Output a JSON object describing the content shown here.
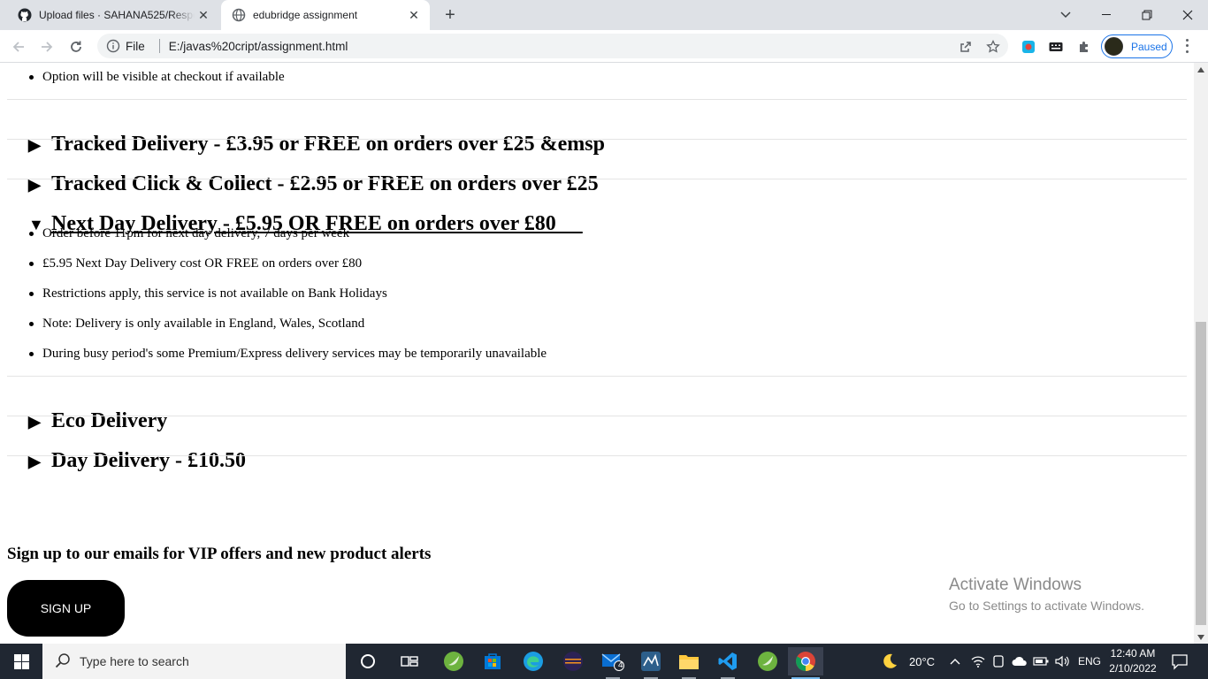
{
  "browser": {
    "tabs": [
      {
        "title": "Upload files · SAHANA525/Respo",
        "favicon": "github-icon"
      },
      {
        "title": "edubridge assignment",
        "favicon": "globe-icon"
      }
    ],
    "address": {
      "scheme_label": "File",
      "url": "E:/javas%20cript/assignment.html"
    },
    "profile_status": "Paused"
  },
  "page": {
    "top_bullet": "Option will be visible at checkout if available",
    "sections": [
      {
        "title": "Tracked Delivery - £3.95 or FREE on orders over £25 &emsp",
        "open": false
      },
      {
        "title": "Tracked Click & Collect - £2.95 or FREE on orders over £25",
        "open": false
      },
      {
        "title": "Next Day Delivery - £5.95 OR FREE on orders over £80     ",
        "open": true,
        "items": [
          "Order before 11pm for next day delivery, 7 days per week",
          "£5.95 Next Day Delivery cost OR FREE on orders over £80",
          "Restrictions apply, this service is not available on Bank Holidays",
          "Note: Delivery is only available in England, Wales, Scotland",
          "During busy period's some Premium/Express delivery services may be temporarily unavailable"
        ]
      },
      {
        "title": "Eco Delivery",
        "open": false
      },
      {
        "title": "Day Delivery - £10.50",
        "open": false
      }
    ],
    "signup_heading": "Sign up to our emails for VIP offers and new product alerts",
    "signup_button": "SIGN UP",
    "watermark": {
      "line1": "Activate Windows",
      "line2": "Go to Settings to activate Windows."
    },
    "markers": {
      "closed": "▶",
      "open": "▼"
    }
  },
  "taskbar": {
    "search_placeholder": "Type here to search",
    "mail_badge": "4",
    "weather": "20°C",
    "language": "ENG",
    "time": "12:40 AM",
    "date": "2/10/2022"
  }
}
